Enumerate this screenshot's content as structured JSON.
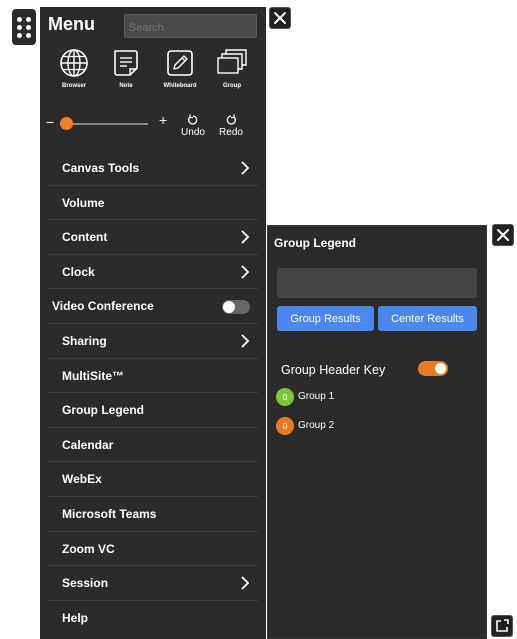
{
  "menu": {
    "title": "Menu",
    "search_placeholder": "Search",
    "tools": [
      {
        "label": "Browser",
        "icon": "globe-icon"
      },
      {
        "label": "Note",
        "icon": "note-icon"
      },
      {
        "label": "Whiteboard",
        "icon": "whiteboard-icon"
      },
      {
        "label": "Group",
        "icon": "group-icon"
      }
    ],
    "volume": {
      "minus": "−",
      "plus": "+",
      "level": 0.05
    },
    "undo_label": "Undo",
    "redo_label": "Redo",
    "items": [
      {
        "label": "Canvas Tools",
        "has_submenu": true
      },
      {
        "label": "Volume",
        "has_submenu": false
      },
      {
        "label": "Content",
        "has_submenu": true
      },
      {
        "label": "Clock",
        "has_submenu": true
      },
      {
        "label": "Video Conference",
        "toggle": "off"
      },
      {
        "label": "Sharing",
        "has_submenu": true
      },
      {
        "label": "MultiSite™",
        "has_submenu": false
      },
      {
        "label": "Group Legend",
        "has_submenu": false
      },
      {
        "label": "Calendar",
        "has_submenu": false
      },
      {
        "label": "WebEx",
        "has_submenu": false
      },
      {
        "label": "Microsoft Teams",
        "has_submenu": false
      },
      {
        "label": "Zoom VC",
        "has_submenu": false
      },
      {
        "label": "Session",
        "has_submenu": true
      },
      {
        "label": "Help",
        "has_submenu": false
      }
    ]
  },
  "legend": {
    "title": "Group Legend",
    "group_results_label": "Group Results",
    "center_results_label": "Center Results",
    "header_key_label": "Group Header Key",
    "header_key_on": true,
    "groups": [
      {
        "count": "0",
        "label": "Group 1",
        "color": "#7cc63d"
      },
      {
        "count": "0",
        "label": "Group 2",
        "color": "#e67c22"
      }
    ]
  },
  "colors": {
    "panel": "#2b2b2b",
    "accent": "#ef7d21",
    "button": "#4a88ee"
  }
}
